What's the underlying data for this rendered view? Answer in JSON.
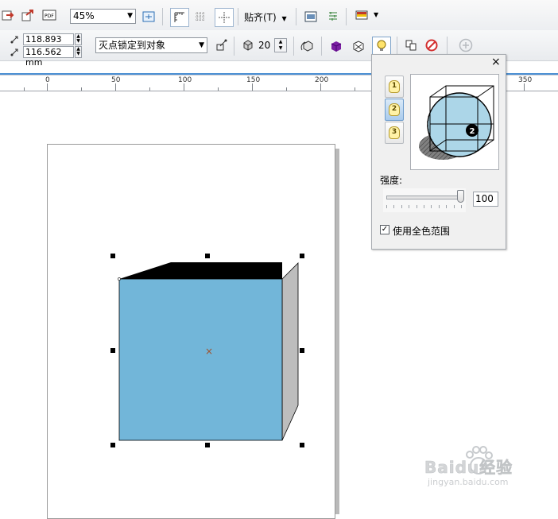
{
  "toolbar": {
    "zoom_value": "45%",
    "snap_label": "贴齐(T)"
  },
  "property_bar": {
    "pos_x": "118.893 mm",
    "pos_y": "116.562 mm",
    "vanishing_point": "灭点锁定到对象",
    "depth": "20"
  },
  "ruler": {
    "labels": [
      "0",
      "50",
      "100",
      "150",
      "200",
      "350"
    ]
  },
  "lighting_panel": {
    "close_label": "×",
    "lights": [
      "1",
      "2",
      "3"
    ],
    "active_light": "2",
    "intensity_label": "强度:",
    "intensity_value": "100",
    "intensity": 100,
    "full_color_label": "使用全色范围",
    "full_color_checked": true,
    "check_mark": "✓"
  },
  "cube": {
    "front_color": "#72b6d9",
    "top_color": "#000000",
    "side_color": "#bdbdbd",
    "center_mark": "×"
  },
  "watermark": {
    "brand": "Baidu经验",
    "url": "jingyan.baidu.com"
  }
}
